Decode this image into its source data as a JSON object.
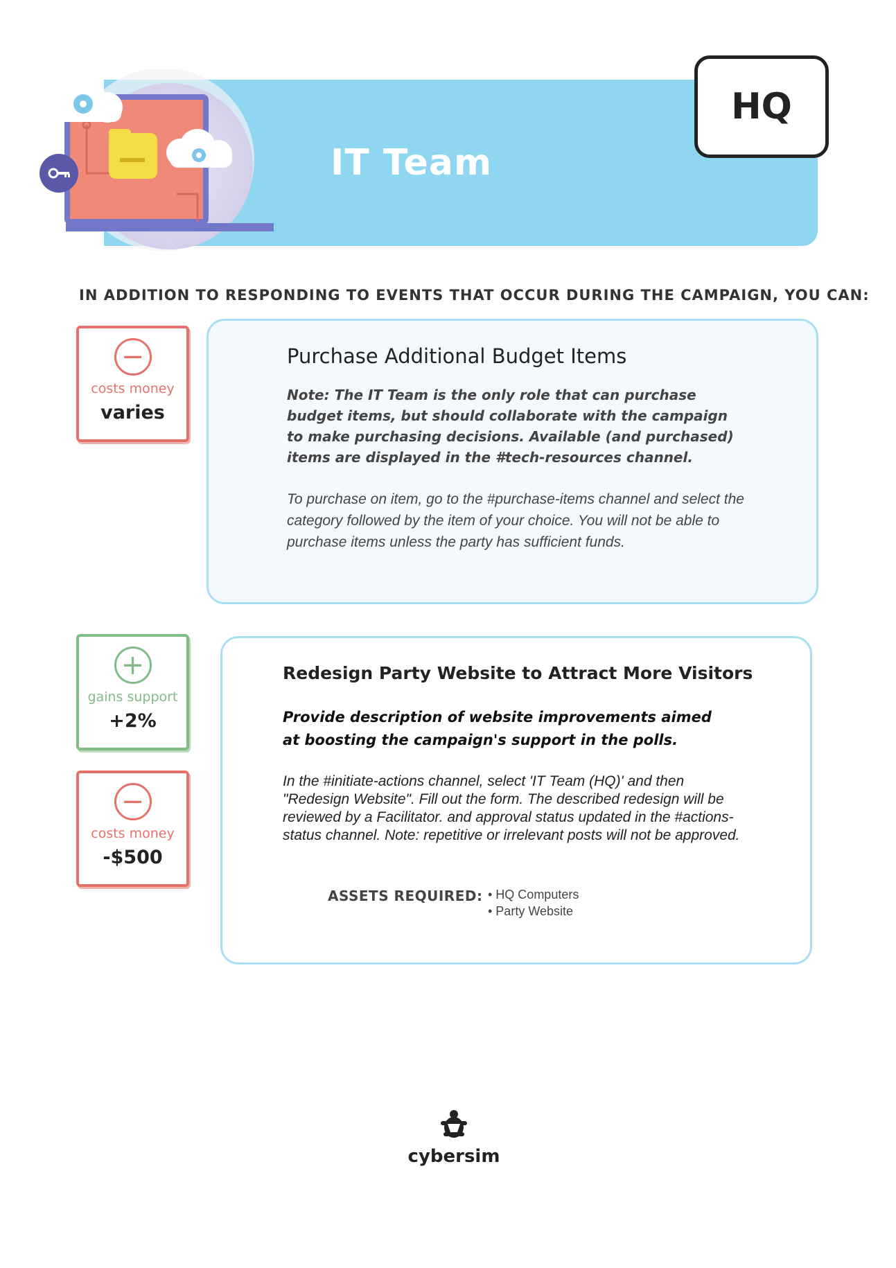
{
  "header": {
    "title": "IT Team",
    "location_badge": "HQ"
  },
  "intro": "IN ADDITION TO RESPONDING TO EVENTS THAT OCCUR DURING THE CAMPAIGN, YOU CAN:",
  "actions": [
    {
      "title": "Purchase Additional Budget Items",
      "note": "Note: The IT Team is the only role that can purchase budget items, but should collaborate with the campaign to make purchasing decisions. Available (and purchased) items are displayed in the #tech-resources channel.",
      "instructions": "To purchase on item, go to the #purchase-items channel and select the category followed by the item of your choice. You will not be able to purchase items unless the party has sufficient funds.",
      "badges": [
        {
          "type": "cost",
          "symbol": "−",
          "label": "costs money",
          "value": "varies",
          "color": "#e4726a"
        }
      ]
    },
    {
      "title": "Redesign Party Website to Attract More Visitors",
      "note": "Provide description of website improvements aimed at boosting the campaign's support in the polls.",
      "instructions": "In the #initiate-actions channel, select 'IT Team (HQ)' and then \"Redesign Website\". Fill out the form. The described redesign will be reviewed by a Facilitator. and approval status updated in the #actions-status channel. Note: repetitive or irrelevant posts will not be approved.",
      "assets_label": "ASSETS REQUIRED:",
      "assets": [
        "• HQ Computers",
        "• Party Website"
      ],
      "badges": [
        {
          "type": "gain",
          "symbol": "+",
          "label": "gains support",
          "value": "+2%",
          "color": "#7fbd84"
        },
        {
          "type": "cost",
          "symbol": "−",
          "label": "costs money",
          "value": "-$500",
          "color": "#e4726a"
        }
      ]
    }
  ],
  "footer": {
    "logo_text": "cybersim",
    "logo_icon": "turtle-icon"
  },
  "colors": {
    "banner": "#8fd6f0",
    "card_border": "#a9dff2",
    "cost": "#e4726a",
    "gain": "#7fbd84"
  }
}
